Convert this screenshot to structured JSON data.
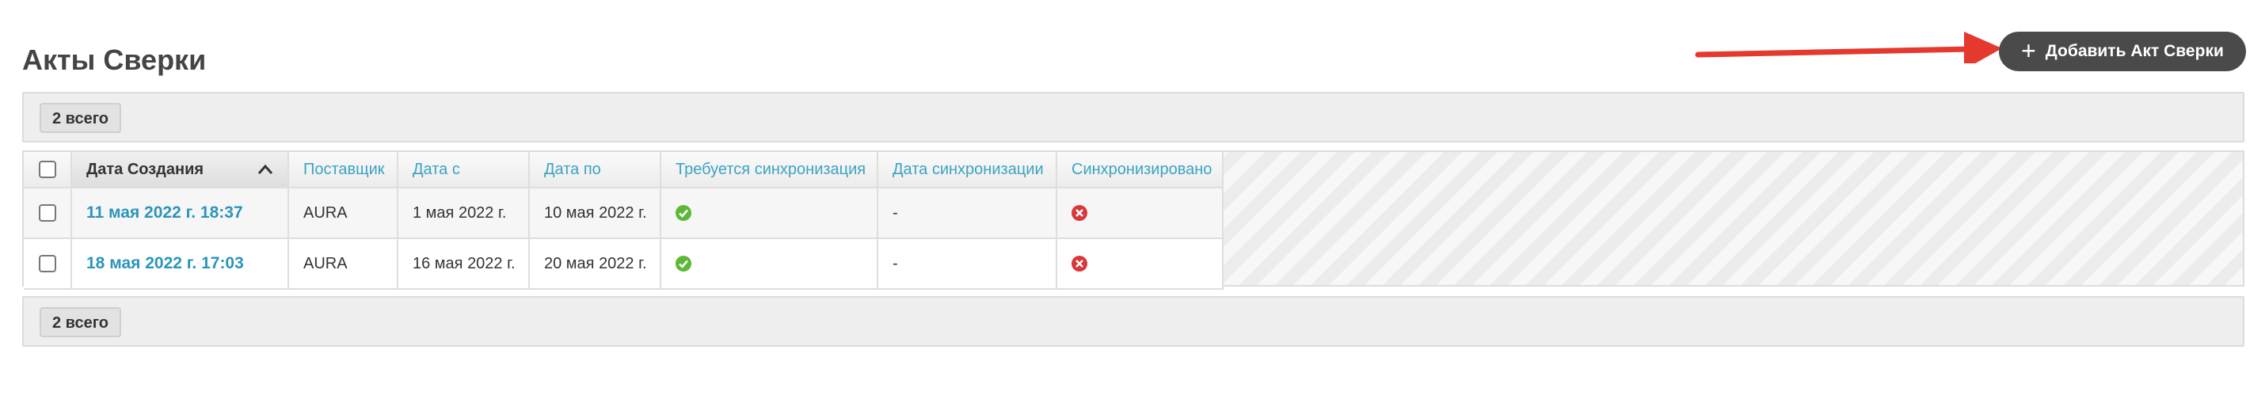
{
  "page": {
    "title": "Акты Сверки",
    "add_button_label": "Добавить Акт Сверки"
  },
  "summary": {
    "top_count": "2 всего",
    "bottom_count": "2 всего"
  },
  "table": {
    "columns": [
      "Дата Создания",
      "Поставщик",
      "Дата с",
      "Дата по",
      "Требуется синхронизация",
      "Дата синхронизации",
      "Синхронизировано"
    ],
    "sorted_column": "Дата Создания",
    "rows": [
      {
        "created": "11 мая 2022 г. 18:37",
        "supplier": "AURA",
        "date_from": "1 мая 2022 г.",
        "date_to": "10 мая 2022 г.",
        "sync_required": "check-icon",
        "sync_date": "-",
        "synced": "cross-icon"
      },
      {
        "created": "18 мая 2022 г. 17:03",
        "supplier": "AURA",
        "date_from": "16 мая 2022 г.",
        "date_to": "20 мая 2022 г.",
        "sync_required": "check-icon",
        "sync_date": "-",
        "synced": "cross-icon"
      }
    ]
  },
  "colors": {
    "link": "#2b95bb",
    "header_text": "#3ba3c2",
    "button_bg": "#4a4a4a",
    "arrow": "#e5382e",
    "check": "#5cb836",
    "cross": "#d9383a"
  }
}
